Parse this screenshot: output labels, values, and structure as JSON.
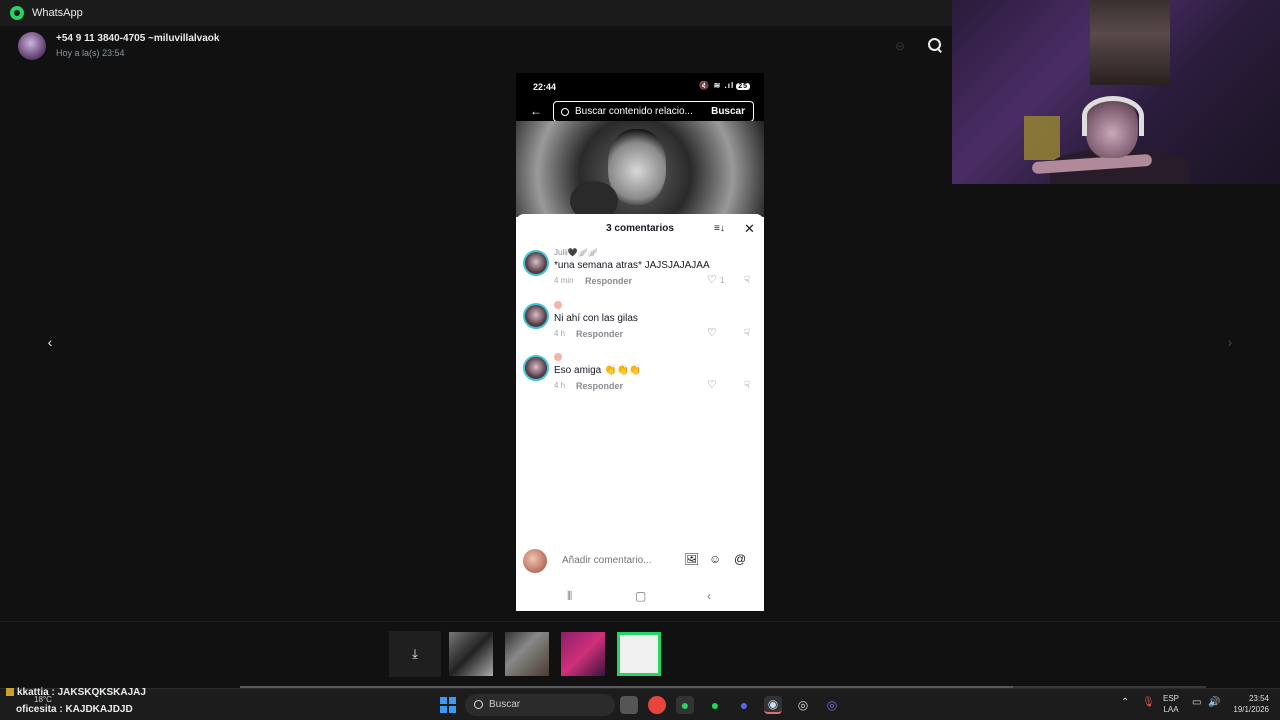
{
  "window": {
    "app_title": "WhatsApp"
  },
  "chat_header": {
    "contact": "+54 9 11 3840-4705 ~miluvillalvaok",
    "subtitle": "Hoy a la(s) 23:54"
  },
  "phone": {
    "time": "22:44",
    "status_icons": "🔇 ≋ .ıl",
    "battery": "25",
    "search_placeholder": "Buscar contenido relacio...",
    "search_button": "Buscar",
    "comments_title": "3 comentarios",
    "comments": [
      {
        "user": "Julii🖤🪽🪽",
        "text": "*una semana atras* JAJSJAJAJAA",
        "time": "4 min",
        "reply": "Responder",
        "likes": "1"
      },
      {
        "user": "",
        "text": "Ni ahí con las gilas",
        "time": "4 h",
        "reply": "Responder",
        "likes": ""
      },
      {
        "user": "",
        "text": "Eso amiga 👏👏👏",
        "time": "4 h",
        "reply": "Responder",
        "likes": ""
      }
    ],
    "composer_placeholder": "Añadir comentario..."
  },
  "ticker": {
    "line1": "kkattia : JAKSKQKSKAJAJ",
    "line2": "oficesita : KAJDKAJDJD",
    "weather": "18°C"
  },
  "taskbar": {
    "search_label": "Buscar",
    "lang_top": "ESP",
    "lang_bottom": "LAA",
    "time": "23:54",
    "date": "19/1/2026"
  },
  "media_progress": 0.8,
  "colors": {
    "accent": "#25d366",
    "avatar_ring": "#43c4d8"
  },
  "icons": {
    "back": "arrow-left-icon",
    "zoom": "zoom-in-icon",
    "sort": "sort-icon",
    "close": "close-icon",
    "heart": "heart-icon",
    "dislike": "dislike-icon",
    "download": "download-icon"
  }
}
